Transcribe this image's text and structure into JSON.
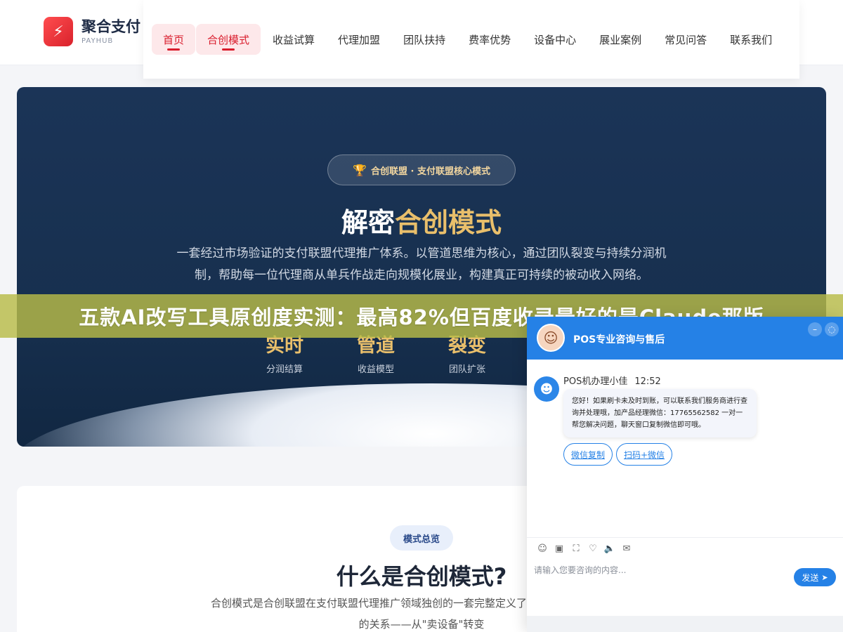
{
  "header": {
    "logo_glyph": "⚡",
    "brand_name": "聚合支付",
    "brand_sub": "PAYHUB",
    "nav": [
      {
        "label": "首页",
        "active": true
      },
      {
        "label": "合创模式",
        "active": true
      },
      {
        "label": "收益试算",
        "active": false
      },
      {
        "label": "代理加盟",
        "active": false
      },
      {
        "label": "团队扶持",
        "active": false
      },
      {
        "label": "费率优势",
        "active": false
      },
      {
        "label": "设备中心",
        "active": false
      },
      {
        "label": "展业案例",
        "active": false
      },
      {
        "label": "常见问答",
        "active": false
      },
      {
        "label": "联系我们",
        "active": false
      }
    ]
  },
  "hero": {
    "badge_icon": "trophy-icon",
    "badge_text": "合创联盟 · 支付联盟核心模式",
    "title_plain": "解密",
    "title_gold": "合创模式",
    "description": "一套经过市场验证的支付联盟代理推广体系。以管道思维为核心，通过团队裂变与持续分润机制，帮助每一位代理商从单兵作战走向规模化展业，构建真正可持续的被动收入网络。",
    "stats": [
      {
        "value": "实时",
        "label": "分润结算"
      },
      {
        "value": "管道",
        "label": "收益模型"
      },
      {
        "value": "裂变",
        "label": "团队扩张"
      }
    ]
  },
  "banner": {
    "text": "五款AI改写工具原创度实测：最高82%但百度收录最好的是Claude那版"
  },
  "intro": {
    "pill": "模式总览",
    "title": "什么是合创模式?",
    "description": "合创模式是合创联盟在支付联盟代理推广领域独创的一套完整定义了代理商与支付终端之间的关系——从\"卖设备\"转变"
  },
  "chat": {
    "header_title": "POS专业咨询与售后",
    "agent_name": "POS机办理小佳",
    "time": "12:52",
    "message": "您好！如果刷卡未及时到账，可以联系我们服务商进行查询并处理哦，加产品经理微信：17765562582 一对一帮您解决问题，聊天窗口复制微信即可哦。",
    "quick_replies": [
      "微信复制",
      "扫码+微信"
    ],
    "input_placeholder": "请输入您要咨询的内容...",
    "send_label": "发送",
    "colors": {
      "primary": "#2581e6",
      "brand_red": "#d91c2c",
      "gold": "#e9bf6b",
      "hero_bg": "#1b3457"
    }
  }
}
